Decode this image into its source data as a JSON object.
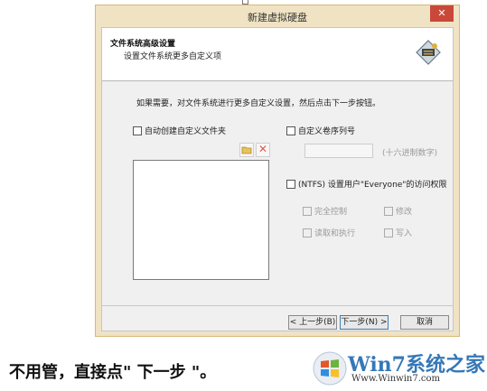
{
  "window": {
    "title": "新建虚拟硬盘",
    "close_glyph": "✕"
  },
  "header": {
    "title": "文件系统高级设置",
    "subtitle": "设置文件系统更多自定义项"
  },
  "instruction": "如果需要，对文件系统进行更多自定义设置，然后点击下一步按钮。",
  "left": {
    "auto_create_label": "自动创建自定义文件夹",
    "delete_glyph": "✕"
  },
  "right": {
    "custom_serial_label": "自定义卷序列号",
    "serial_value": "",
    "serial_hint": "(十六进制数字)",
    "ntfs_label": "(NTFS) 设置用户\"Everyone\"的访问权限",
    "perm_full": "完全控制",
    "perm_modify": "修改",
    "perm_read_exec": "读取和执行",
    "perm_write": "写入"
  },
  "buttons": {
    "back": "< 上一步(B)",
    "next": "下一步(N) >",
    "cancel": "取消"
  },
  "caption": "不用管，直接点\" 下一步 \"。",
  "watermark": {
    "brand": "Win7系统之家",
    "url": "Www.Winwin7.com"
  },
  "colors": {
    "close_red": "#c9483a",
    "frame": "#f0e3c4",
    "brand_blue": "#3578b8"
  }
}
